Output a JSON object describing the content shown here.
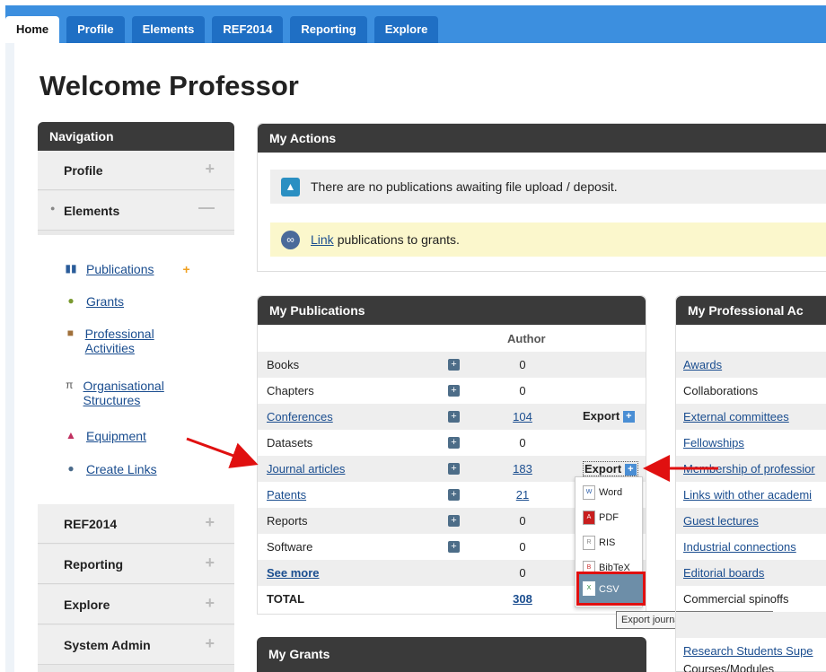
{
  "tabs": [
    "Home",
    "Profile",
    "Elements",
    "REF2014",
    "Reporting",
    "Explore"
  ],
  "page_title": "Welcome Professor",
  "navigation": {
    "title": "Navigation",
    "profile": "Profile",
    "elements": "Elements",
    "sub_items": [
      "Publications",
      "Grants",
      "Professional Activities",
      "Organisational Structures",
      "Equipment",
      "Create Links"
    ],
    "bottom_items": [
      "REF2014",
      "Reporting",
      "Explore",
      "System Admin"
    ]
  },
  "actions": {
    "title": "My Actions",
    "no_publications": "There are no publications awaiting file upload / deposit.",
    "link_word": "Link",
    "link_rest": "publications to grants."
  },
  "publications": {
    "title": "My Publications",
    "author_header": "Author",
    "rows": [
      {
        "name": "Books",
        "count": "0"
      },
      {
        "name": "Chapters",
        "count": "0"
      },
      {
        "name": "Conferences",
        "count": "104"
      },
      {
        "name": "Datasets",
        "count": "0"
      },
      {
        "name": "Journal articles",
        "count": "183"
      },
      {
        "name": "Patents",
        "count": "21"
      },
      {
        "name": "Reports",
        "count": "0"
      },
      {
        "name": "Software",
        "count": "0"
      },
      {
        "name": "See more",
        "count": "0"
      },
      {
        "name": "TOTAL",
        "count": "308"
      }
    ],
    "export_label": "Export",
    "export_menu": [
      "Word",
      "PDF",
      "RIS",
      "BibTeX",
      "CSV"
    ],
    "tooltip": "Export journal article data to CSV"
  },
  "professional": {
    "title": "My Professional Ac",
    "rows": [
      "Awards",
      "Collaborations",
      "External committees",
      "Fellowships",
      "Membership of professior",
      "Links with other academi",
      "Guest lectures",
      "Industrial connections",
      "Editorial boards",
      "Commercial spinoffs",
      "",
      "Research Students Supe",
      "Courses/Modules"
    ]
  },
  "grants": {
    "title": "My Grants"
  },
  "colors": {
    "tab_bar": "#3c8fdf",
    "tab": "#1f6fc4",
    "panel_header": "#3a3a3a",
    "highlight": "#e01010"
  }
}
